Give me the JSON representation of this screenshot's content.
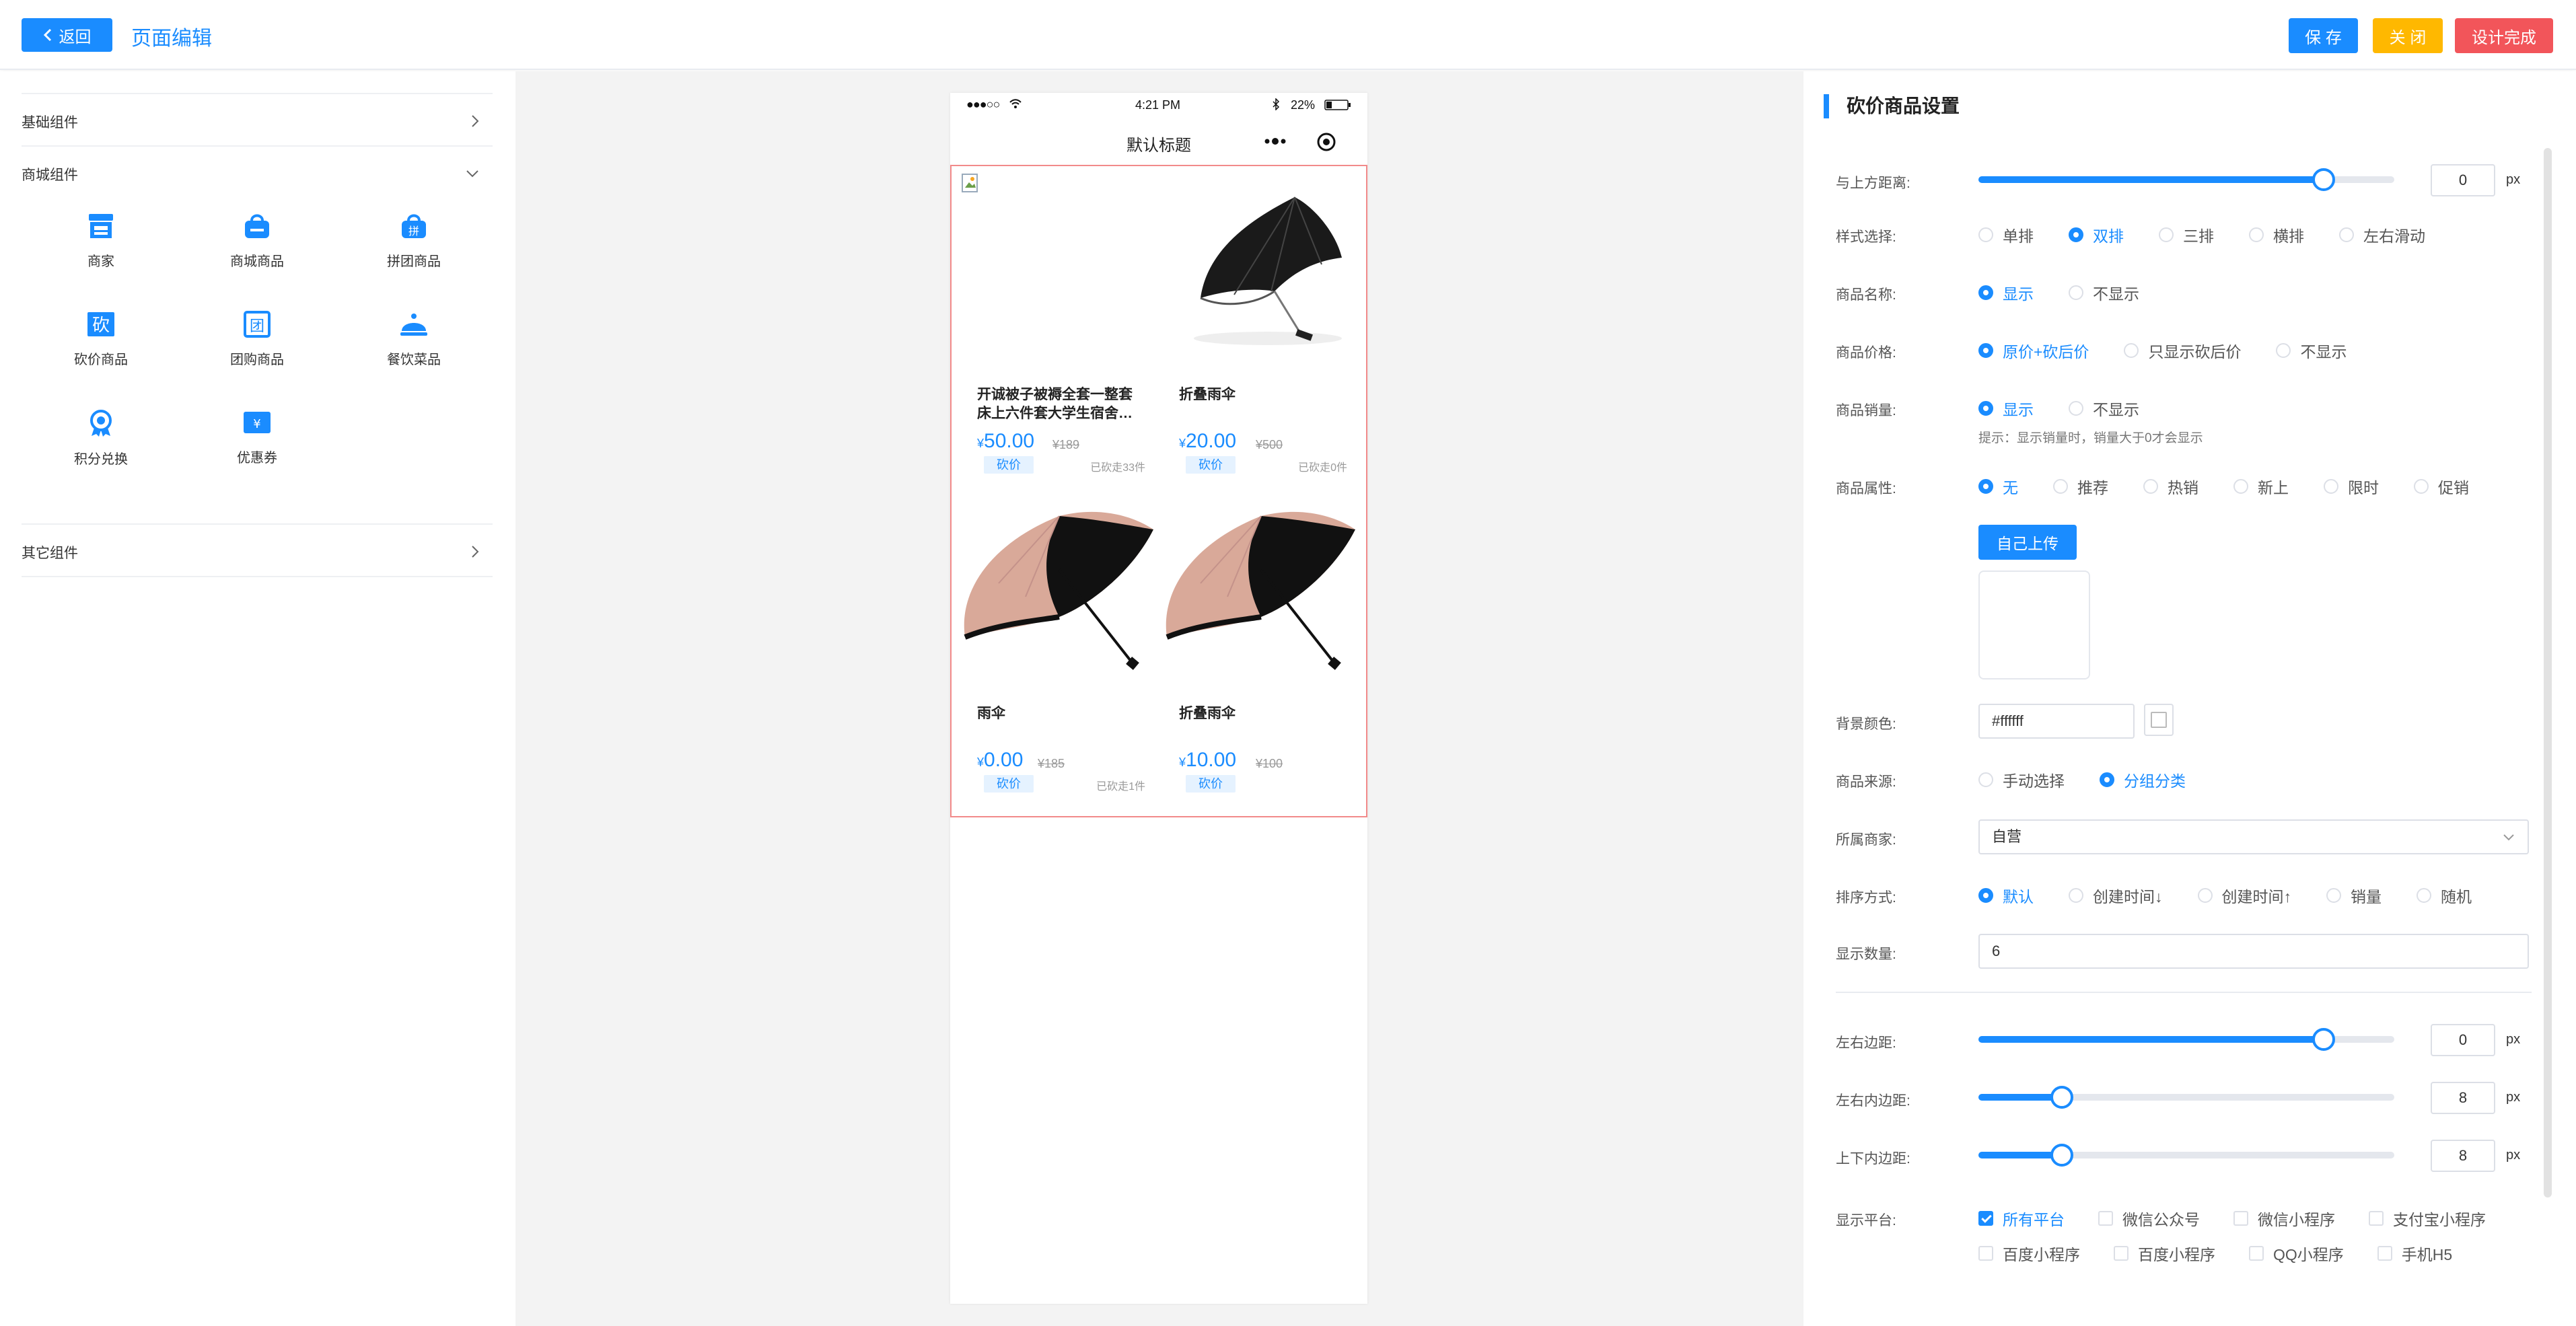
{
  "header": {
    "back_label": "返回",
    "title": "页面编辑",
    "save_label": "保 存",
    "close_label": "关 闭",
    "done_label": "设计完成"
  },
  "sidebar": {
    "sections": [
      "基础组件",
      "商城组件",
      "其它组件"
    ],
    "components": [
      {
        "label": "商家",
        "icon": "shop-icon"
      },
      {
        "label": "商城商品",
        "icon": "bag-icon"
      },
      {
        "label": "拼团商品",
        "icon": "group-buy-icon"
      },
      {
        "label": "砍价商品",
        "icon": "bargain-icon"
      },
      {
        "label": "团购商品",
        "icon": "team-buy-icon"
      },
      {
        "label": "餐饮菜品",
        "icon": "food-cover-icon"
      },
      {
        "label": "积分兑换",
        "icon": "points-icon"
      },
      {
        "label": "优惠券",
        "icon": "coupon-icon"
      }
    ]
  },
  "phone": {
    "carrier": "●●●○○",
    "time": "4:21 PM",
    "battery": "22%",
    "title": "默认标题",
    "goods": [
      {
        "name": "开诚被子被褥全套一整套床上六件套大学生宿舍…",
        "price": "50.00",
        "old_price": "189",
        "tag": "砍价",
        "sold": "已砍走33件",
        "image": "broken-image"
      },
      {
        "name": "折叠雨伞",
        "price": "20.00",
        "old_price": "500",
        "tag": "砍价",
        "sold": "已砍走0件",
        "image": "black-umbrella"
      },
      {
        "name": "雨伞",
        "price": "0.00",
        "old_price": "185",
        "tag": "砍价",
        "sold": "已砍走1件",
        "image": "pink-umbrella"
      },
      {
        "name": "折叠雨伞",
        "price": "10.00",
        "old_price": "100",
        "tag": "砍价",
        "sold": "",
        "image": "pink-umbrella"
      }
    ],
    "currency": "¥"
  },
  "settings": {
    "heading": "砍价商品设置",
    "top_margin": {
      "label": "与上方距离:",
      "value": "0",
      "unit": "px",
      "level": 0.83
    },
    "style": {
      "label": "样式选择:",
      "options": [
        "单排",
        "双排",
        "三排",
        "横排",
        "左右滑动"
      ],
      "selected": 1
    },
    "show_name": {
      "label": "商品名称:",
      "options": [
        "显示",
        "不显示"
      ],
      "selected": 0
    },
    "show_price": {
      "label": "商品价格:",
      "options": [
        "原价+砍后价",
        "只显示砍后价",
        "不显示"
      ],
      "selected": 0
    },
    "show_sales": {
      "label": "商品销量:",
      "options": [
        "显示",
        "不显示"
      ],
      "selected": 0
    },
    "sales_hint": "提示：显示销量时，销量大于0才会显示",
    "attribute": {
      "label": "商品属性:",
      "options": [
        "无",
        "推荐",
        "热销",
        "新上",
        "限时",
        "促销"
      ],
      "selected": 0
    },
    "upload_label": "自己上传",
    "bg_color": {
      "label": "背景颜色:",
      "value": "#ffffff"
    },
    "source": {
      "label": "商品来源:",
      "options": [
        "手动选择",
        "分组分类"
      ],
      "selected": 1
    },
    "merchant": {
      "label": "所属商家:",
      "value": "自营"
    },
    "sort": {
      "label": "排序方式:",
      "options": [
        "默认",
        "创建时间↓",
        "创建时间↑",
        "销量",
        "随机"
      ],
      "selected": 0
    },
    "count": {
      "label": "显示数量:",
      "value": "6"
    },
    "lr_margin": {
      "label": "左右边距:",
      "value": "0",
      "unit": "px",
      "level": 0.83
    },
    "lr_padding": {
      "label": "左右内边距:",
      "value": "8",
      "unit": "px",
      "level": 0.2
    },
    "tb_padding": {
      "label": "上下内边距:",
      "value": "8",
      "unit": "px",
      "level": 0.2
    },
    "platform": {
      "label": "显示平台:",
      "options": [
        "所有平台",
        "微信公众号",
        "微信小程序",
        "支付宝小程序",
        "百度小程序",
        "百度小程序",
        "QQ小程序",
        "手机H5"
      ],
      "checked": [
        0
      ]
    }
  },
  "colors": {
    "accent": "#1a8cff",
    "warning": "#ffb800",
    "danger": "#f2555a"
  }
}
